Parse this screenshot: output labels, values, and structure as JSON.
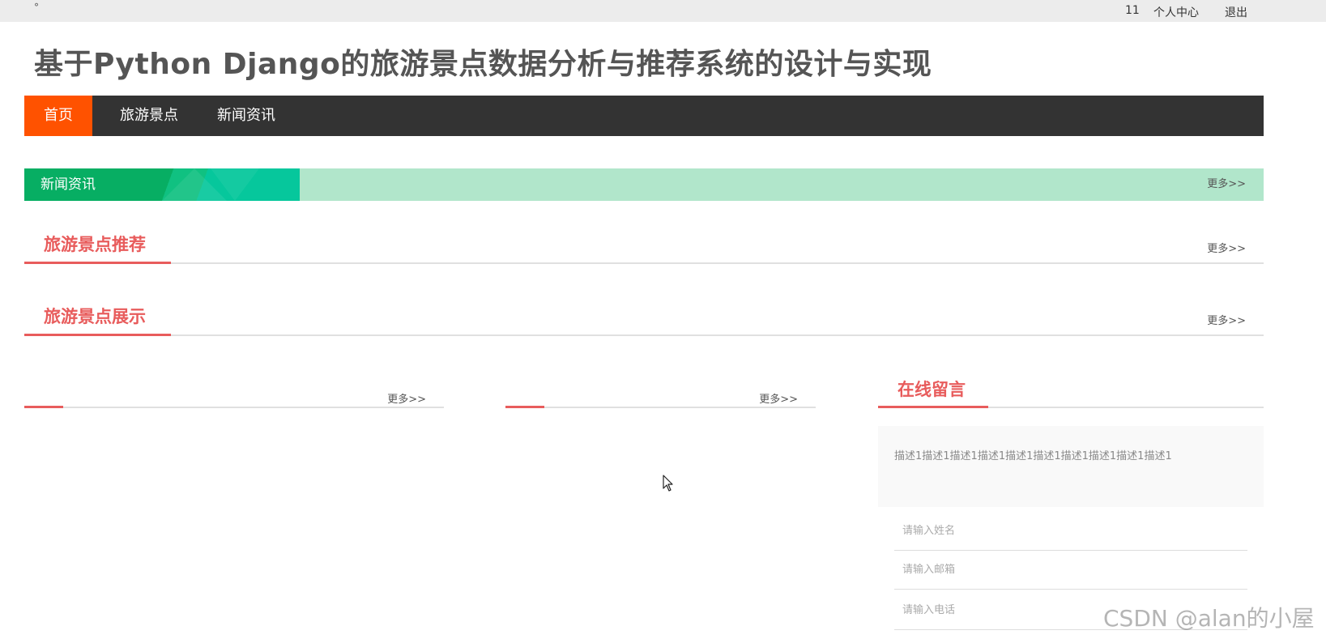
{
  "topbar": {
    "dot": "°",
    "user_id": "11",
    "personal_center": "个人中心",
    "logout": "退出"
  },
  "site": {
    "title": "基于Python Django的旅游景点数据分析与推荐系统的设计与实现"
  },
  "nav": {
    "items": [
      {
        "label": "首页",
        "active": true
      },
      {
        "label": "旅游景点",
        "active": false
      },
      {
        "label": "新闻资讯",
        "active": false
      }
    ]
  },
  "news_bar": {
    "label": "新闻资讯",
    "more": "更多>>"
  },
  "sections": {
    "recommend": {
      "title": "旅游景点推荐",
      "more": "更多>>"
    },
    "display": {
      "title": "旅游景点展示",
      "more": "更多>>"
    }
  },
  "columns": {
    "left": {
      "more": "更多>>"
    },
    "middle": {
      "more": "更多>>"
    }
  },
  "message": {
    "title": "在线留言",
    "description": "描述1描述1描述1描述1描述1描述1描述1描述1描述1描述1",
    "name_placeholder": "请输入姓名",
    "email_placeholder": "请输入邮箱",
    "phone_placeholder": "请输入电话"
  },
  "watermark": "CSDN @alan的小屋",
  "colors": {
    "accent_orange": "#ff5200",
    "nav_bg": "#333333",
    "section_red": "#e85c5c",
    "news_green": "#07ae63",
    "news_bar_bg": "#b1e6cb"
  }
}
